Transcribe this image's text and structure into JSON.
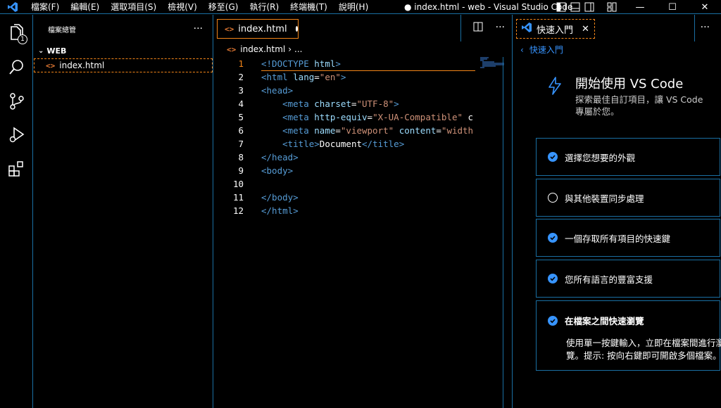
{
  "menu": [
    "檔案(F)",
    "編輯(E)",
    "選取項目(S)",
    "檢視(V)",
    "移至(G)",
    "執行(R)",
    "終端機(T)",
    "說明(H)"
  ],
  "window_title": "● index.html - web - Visual Studio Code",
  "activity": {
    "explorer_badge": "1"
  },
  "sidebar": {
    "title": "檔案總管",
    "more": "···",
    "folder": "WEB",
    "file": "index.html"
  },
  "editor": {
    "tab_label": "index.html",
    "breadcrumb_file": "index.html",
    "breadcrumb_more": "...",
    "more": "···",
    "lines": [
      {
        "n": "1",
        "parts": [
          [
            "tag",
            "<!DOCTYPE "
          ],
          [
            "attr",
            "html"
          ],
          [
            "tag",
            ">"
          ]
        ]
      },
      {
        "n": "2",
        "parts": [
          [
            "tag",
            "<html "
          ],
          [
            "attr",
            "lang"
          ],
          [
            "plain",
            "="
          ],
          [
            "str",
            "\"en\""
          ],
          [
            "tag",
            ">"
          ]
        ]
      },
      {
        "n": "3",
        "parts": [
          [
            "tag",
            "<head>"
          ]
        ]
      },
      {
        "n": "4",
        "parts": [
          [
            "plain",
            "    "
          ],
          [
            "tag",
            "<meta "
          ],
          [
            "attr",
            "charset"
          ],
          [
            "plain",
            "="
          ],
          [
            "str",
            "\"UTF-8\""
          ],
          [
            "tag",
            ">"
          ]
        ]
      },
      {
        "n": "5",
        "parts": [
          [
            "plain",
            "    "
          ],
          [
            "tag",
            "<meta "
          ],
          [
            "attr",
            "http-equiv"
          ],
          [
            "plain",
            "="
          ],
          [
            "str",
            "\"X-UA-Compatible\""
          ],
          [
            "plain",
            " c"
          ]
        ]
      },
      {
        "n": "6",
        "parts": [
          [
            "plain",
            "    "
          ],
          [
            "tag",
            "<meta "
          ],
          [
            "attr",
            "name"
          ],
          [
            "plain",
            "="
          ],
          [
            "str",
            "\"viewport\""
          ],
          [
            "plain",
            " "
          ],
          [
            "attr",
            "content"
          ],
          [
            "plain",
            "="
          ],
          [
            "str",
            "\"width"
          ]
        ]
      },
      {
        "n": "7",
        "parts": [
          [
            "plain",
            "    "
          ],
          [
            "tag",
            "<title>"
          ],
          [
            "plain",
            "Document"
          ],
          [
            "tag",
            "</title>"
          ]
        ]
      },
      {
        "n": "8",
        "parts": [
          [
            "tag",
            "</head>"
          ]
        ]
      },
      {
        "n": "9",
        "parts": [
          [
            "tag",
            "<body>"
          ]
        ]
      },
      {
        "n": "10",
        "parts": []
      },
      {
        "n": "11",
        "parts": [
          [
            "tag",
            "</body>"
          ]
        ]
      },
      {
        "n": "12",
        "parts": [
          [
            "tag",
            "</html>"
          ]
        ]
      }
    ]
  },
  "panel": {
    "tab_label": "快速入門",
    "more": "···",
    "back_label": "快速入門",
    "title": "開始使用 VS Code",
    "subtitle": "探索最佳自訂項目，讓 VS Code 專屬於您。",
    "steps": [
      {
        "label": "選擇您想要的外觀",
        "done": true
      },
      {
        "label": "與其他裝置同步處理",
        "done": false
      },
      {
        "label": "一個存取所有項目的快速鍵",
        "done": true
      },
      {
        "label": "您所有語言的豐富支援",
        "done": true
      },
      {
        "label": "在檔案之間快速瀏覽",
        "done": true,
        "description": "使用單一按鍵輸入，立即在檔案間進行瀏覽。提示: 按向右鍵即可開啟多個檔案。"
      }
    ]
  },
  "colors": {
    "accent": "#3794ff",
    "focus_border": "#f38518",
    "border": "#1a6fa3"
  }
}
